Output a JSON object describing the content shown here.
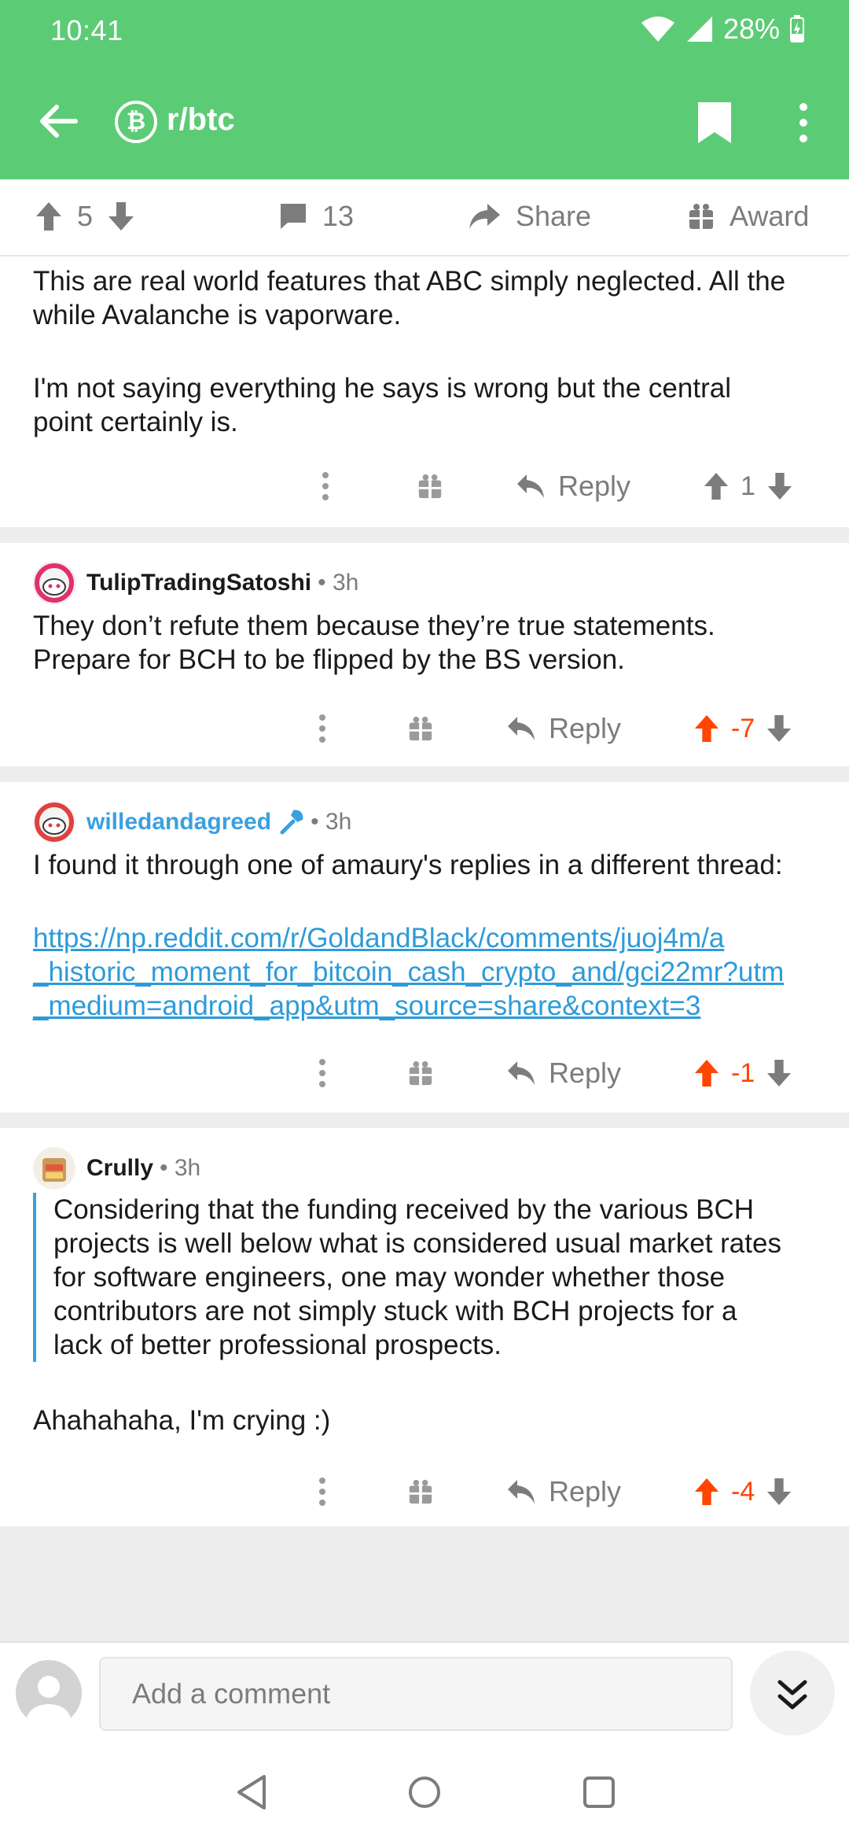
{
  "status": {
    "time": "10:41",
    "battery": "28%"
  },
  "app_bar": {
    "subreddit": "r/btc",
    "sub_icon_letter": "₿"
  },
  "post_actions": {
    "score": "5",
    "comments": "13",
    "share_label": "Share",
    "award_label": "Award"
  },
  "comments": [
    {
      "text_lines": [
        "This are real world features that ABC simply neglected. All the",
        "while Avalanche is vaporware.",
        "",
        "I'm not saying everything he says is wrong  but the central",
        "point certainly is."
      ],
      "reply_label": "Reply",
      "score": "1"
    },
    {
      "username": "TulipTradingSatoshi",
      "meta": "• 3h",
      "text_lines": [
        "They don’t refute them because they’re true statements.",
        "Prepare for BCH to be flipped by the BS version."
      ],
      "reply_label": "Reply",
      "score": "-7"
    },
    {
      "username": "willedandagreed",
      "meta": "• 3h",
      "text_line": "I found it through one of amaury's replies in a different thread:",
      "link_lines": [
        "https://np.reddit.com/r/GoldandBlack/comments/juoj4m/a",
        "_historic_moment_for_bitcoin_cash_crypto_and/gci22mr?utm",
        "_medium=android_app&utm_source=share&context=3"
      ],
      "reply_label": "Reply",
      "score": "-1"
    },
    {
      "username": "Crully",
      "meta": "• 3h",
      "quote_lines": [
        "Considering that the funding received by the various BCH",
        "projects is well below what is considered usual market rates",
        "for software engineers, one may wonder whether those",
        "contributors are not simply stuck with BCH projects for a",
        "lack of better professional prospects."
      ],
      "text_line": "Ahahahaha, I'm crying :)",
      "reply_label": "Reply",
      "score": "-4"
    }
  ],
  "comment_bar": {
    "placeholder": "Add a comment"
  },
  "colors": {
    "header": "#5ccb76",
    "upvote_active": "#ff4500",
    "link": "#2d9bd9",
    "mod_blue": "#3aa0e0"
  }
}
